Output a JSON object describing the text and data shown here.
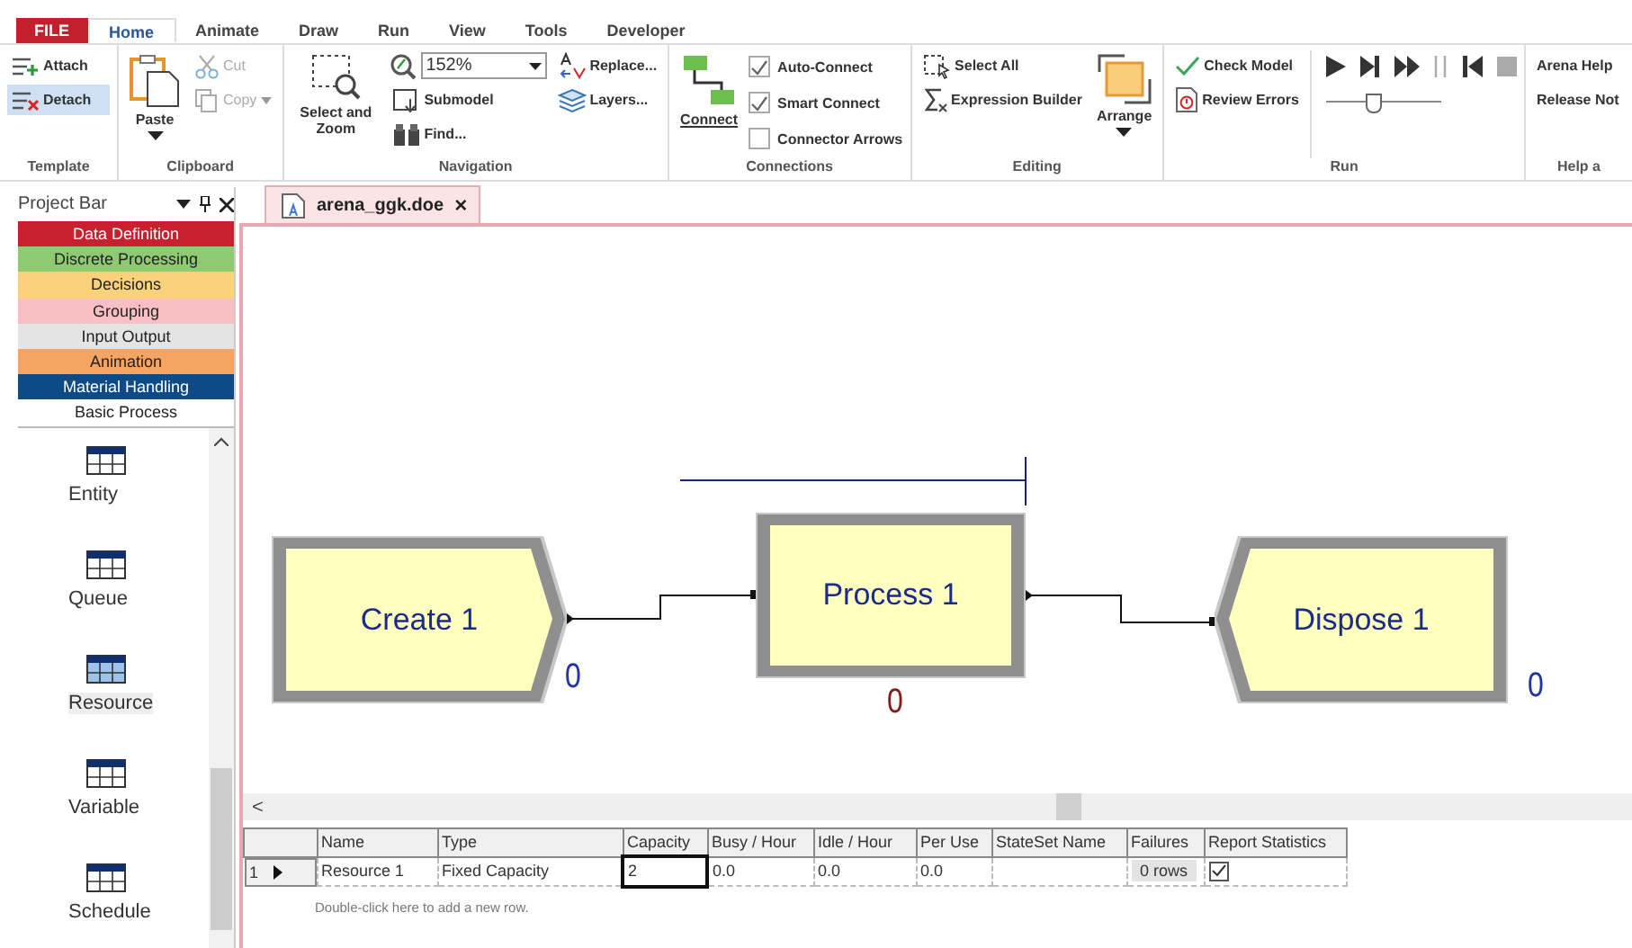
{
  "ribbon_tabs": [
    {
      "label": "FILE",
      "kind": "file",
      "selected": false
    },
    {
      "label": "Home",
      "kind": "tab",
      "selected": true
    },
    {
      "label": "Animate",
      "kind": "tab",
      "selected": false
    },
    {
      "label": "Draw",
      "kind": "tab",
      "selected": false
    },
    {
      "label": "Run",
      "kind": "tab",
      "selected": false
    },
    {
      "label": "View",
      "kind": "tab",
      "selected": false
    },
    {
      "label": "Tools",
      "kind": "tab",
      "selected": false
    },
    {
      "label": "Developer",
      "kind": "tab",
      "selected": false
    }
  ],
  "template": {
    "attach": "Attach",
    "detach": "Detach",
    "detach_selected": true,
    "label": "Template"
  },
  "clipboard": {
    "paste": "Paste",
    "cut": {
      "label": "Cut",
      "disabled": true
    },
    "copy": {
      "label": "Copy",
      "disabled": true
    },
    "label": "Clipboard"
  },
  "navigation": {
    "select_zoom": "Select and Zoom",
    "zoom": "152%",
    "submodel": "Submodel",
    "find": "Find...",
    "replace": "Replace...",
    "layers": "Layers...",
    "label": "Navigation"
  },
  "connections": {
    "connect": "Connect",
    "options": [
      {
        "label": "Auto-Connect",
        "checked": true
      },
      {
        "label": "Smart Connect",
        "checked": true
      },
      {
        "label": "Connector Arrows",
        "checked": false
      }
    ],
    "label": "Connections"
  },
  "editing": {
    "select_all": "Select All",
    "expression_builder": "Expression Builder",
    "arrange": "Arrange",
    "label": "Editing"
  },
  "run": {
    "check_model": "Check Model",
    "review_errors": "Review Errors",
    "speed_slider": {
      "level": 0.4
    },
    "label": "Run"
  },
  "help": {
    "arena_help": "Arena Help",
    "release_notes": "Release Not",
    "label": "Help a"
  },
  "project_bar": {
    "title": "Project Bar",
    "panels": [
      {
        "label": "Data Definition",
        "color": "#c8202f"
      },
      {
        "label": "Discrete Processing",
        "color": "#8fca72"
      },
      {
        "label": "Decisions",
        "color": "#fad27a"
      },
      {
        "label": "Grouping",
        "color": "#f9c0c4"
      },
      {
        "label": "Input Output",
        "color": "#e4e4e4"
      },
      {
        "label": "Animation",
        "color": "#f5a462"
      },
      {
        "label": "Material Handling",
        "color": "#0d4a86"
      },
      {
        "label": "Basic Process",
        "color": "#ffffff"
      }
    ],
    "modules": [
      {
        "label": "Entity",
        "selected": false
      },
      {
        "label": "Queue",
        "selected": false
      },
      {
        "label": "Resource",
        "selected": true
      },
      {
        "label": "Variable",
        "selected": false
      },
      {
        "label": "Schedule",
        "selected": false
      }
    ]
  },
  "document_tab": {
    "title": "arena_ggk.doe",
    "close": "×"
  },
  "flowchart": {
    "modules": [
      {
        "kind": "create",
        "label": "Create 1",
        "count": "0"
      },
      {
        "kind": "process",
        "label": "Process 1",
        "count": "0"
      },
      {
        "kind": "dispose",
        "label": "Dispose 1",
        "count": "0"
      }
    ]
  },
  "scroll_left": "<",
  "table": {
    "columns": [
      "Name",
      "Type",
      "Capacity",
      "Busy / Hour",
      "Idle / Hour",
      "Per Use",
      "StateSet Name",
      "Failures",
      "Report Statistics"
    ],
    "rows": [
      {
        "number": "1",
        "cells": [
          {
            "text": "Resource 1",
            "selected": false
          },
          {
            "text": "Fixed Capacity",
            "selected": false
          },
          {
            "text": "2",
            "selected": true
          },
          {
            "text": "0.0",
            "selected": false
          },
          {
            "text": "0.0",
            "selected": false
          },
          {
            "text": "0.0",
            "selected": false
          },
          {
            "text": "",
            "selected": false
          }
        ],
        "failures": "0 rows",
        "report_statistics": true
      }
    ],
    "add_row_hint": "Double-click here to add a new row."
  }
}
